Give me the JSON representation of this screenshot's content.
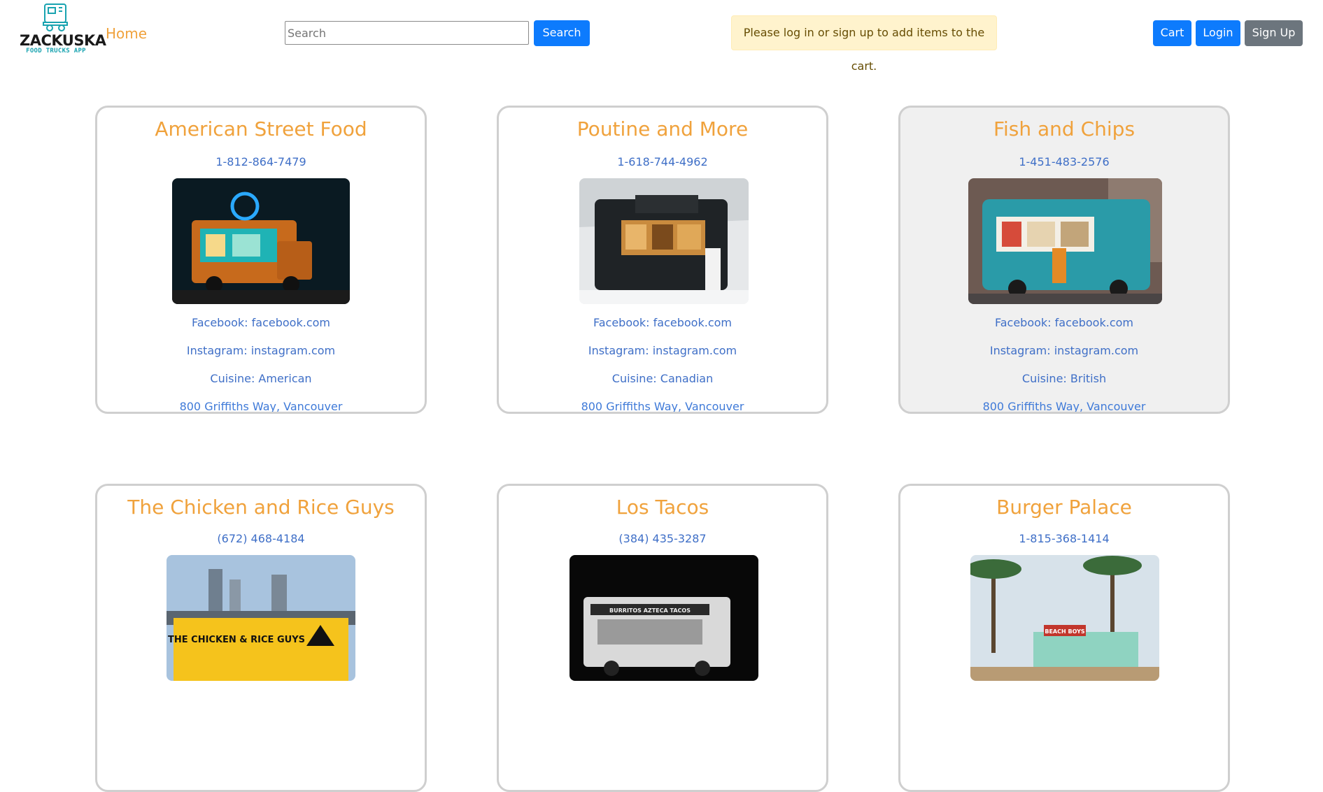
{
  "nav": {
    "logo_word": "ZACKUSKA",
    "logo_sub": "FOOD TRUCKS APP",
    "home_label": "Home",
    "search_placeholder": "Search",
    "search_button": "Search",
    "alert_text": "Please log in or sign up to add items to the cart.",
    "cart_button": "Cart",
    "login_button": "Login",
    "signup_button": "Sign Up"
  },
  "colors": {
    "accent_orange": "#f0a23c",
    "link_blue": "#3f6fc7",
    "primary_button": "#0d7bfd",
    "secondary_button": "#6c757d",
    "alert_bg": "#fff3cd"
  },
  "trucks": [
    {
      "name": "American Street Food",
      "phone": "1-812-864-7479",
      "facebook": "Facebook: facebook.com",
      "instagram": "Instagram: instagram.com",
      "cuisine": "Cuisine: American",
      "address": "800 Griffiths Way, Vancouver",
      "photo_icon": "night-donut-truck-photo"
    },
    {
      "name": "Poutine and More",
      "phone": "1-618-744-4962",
      "facebook": "Facebook: facebook.com",
      "instagram": "Instagram: instagram.com",
      "cuisine": "Cuisine: Canadian",
      "address": "800 Griffiths Way, Vancouver",
      "photo_icon": "snowy-bakery-truck-photo"
    },
    {
      "name": "Fish and Chips",
      "phone": "1-451-483-2576",
      "facebook": "Facebook: facebook.com",
      "instagram": "Instagram: instagram.com",
      "cuisine": "Cuisine: British",
      "address": "800 Griffiths Way, Vancouver",
      "photo_icon": "teal-fish-chips-truck-photo"
    },
    {
      "name": "The Chicken and Rice Guys",
      "phone": "(672) 468-4184",
      "photo_icon": "yellow-chicken-truck-photo",
      "photo_text": "THE CHICKEN & RICE GUYS"
    },
    {
      "name": "Los Tacos",
      "phone": "(384) 435-3287",
      "photo_icon": "night-taco-truck-photo",
      "photo_text": "BURRITOS  AZTECA  TACOS"
    },
    {
      "name": "Burger Palace",
      "phone": "1-815-368-1414",
      "photo_icon": "beach-palm-truck-photo",
      "photo_text": "BEACH BOYS"
    }
  ]
}
